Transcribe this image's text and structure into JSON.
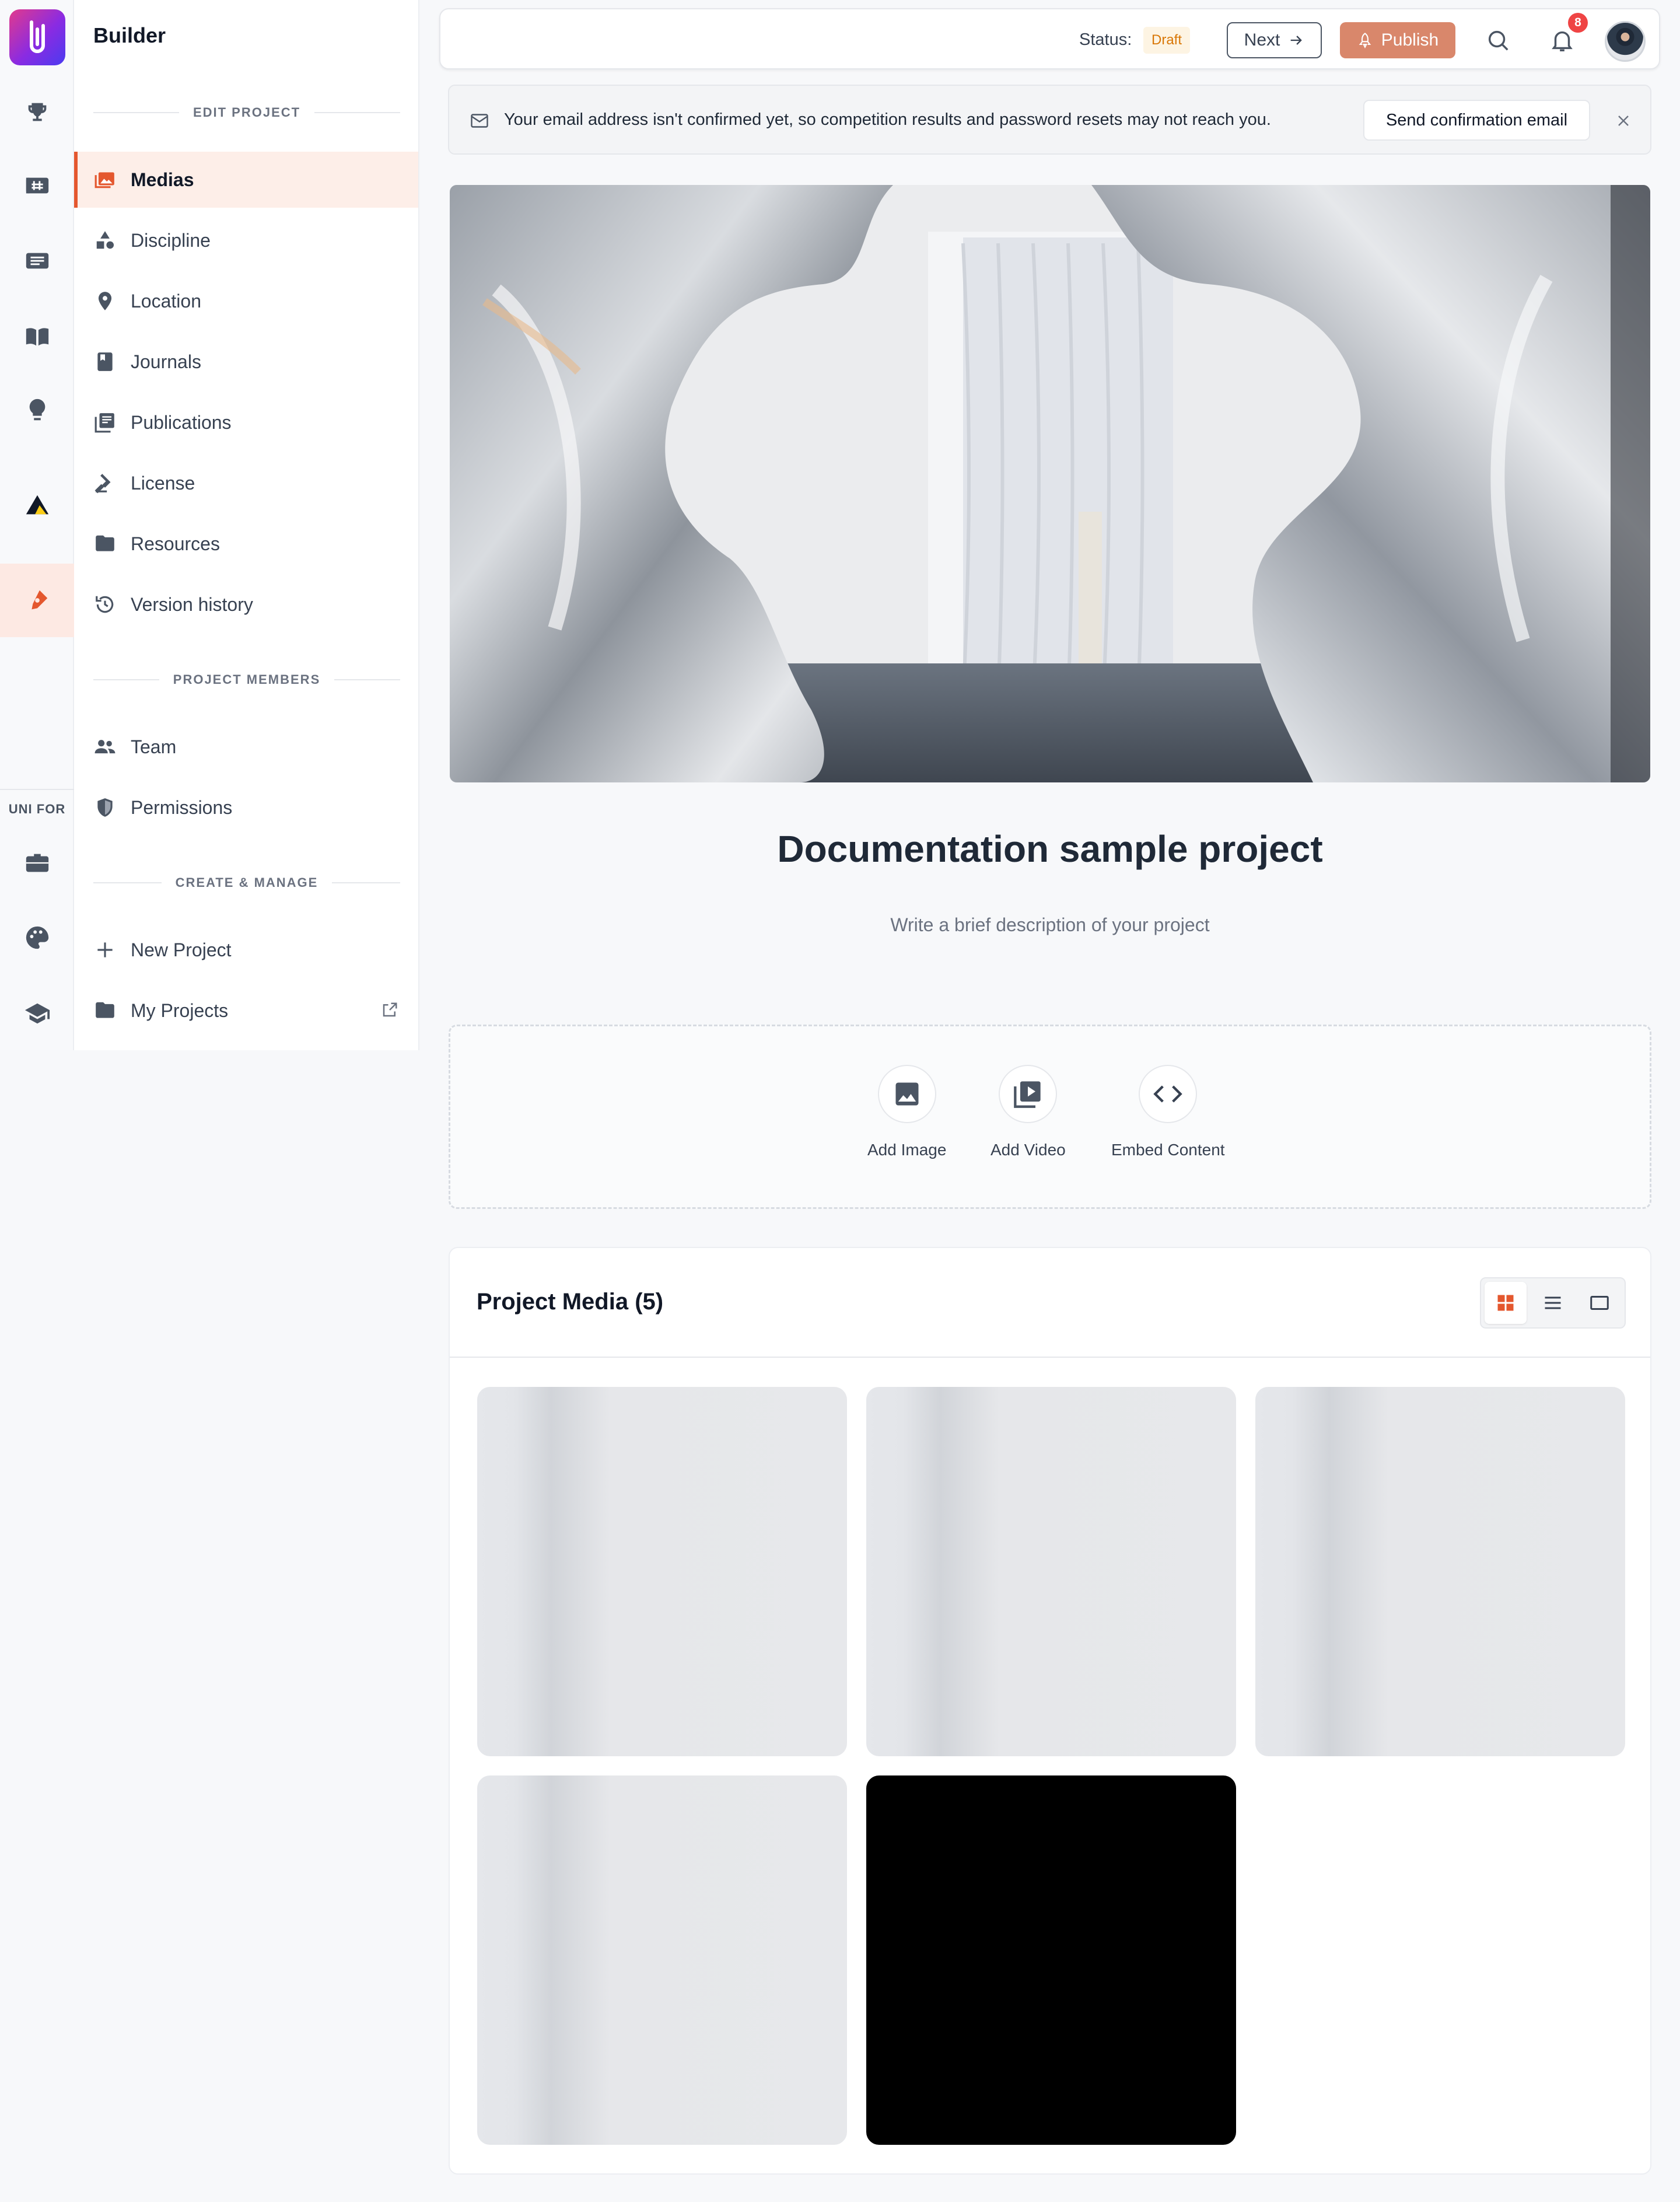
{
  "rail": {
    "section_label": "UNI FOR",
    "icons": [
      "trophy-icon",
      "hashtag-board-icon",
      "list-card-icon",
      "book-open-icon",
      "lightbulb-icon",
      "triangle-logo-icon",
      "builder-pen-icon",
      "briefcase-icon",
      "palette-icon",
      "graduation-cap-icon"
    ]
  },
  "sidebar": {
    "app_name": "Builder",
    "edit_section": "EDIT PROJECT",
    "edit_items": [
      "Medias",
      "Discipline",
      "Location",
      "Journals",
      "Publications",
      "License",
      "Resources",
      "Version history"
    ],
    "members_section": "PROJECT MEMBERS",
    "members_items": [
      "Team",
      "Permissions"
    ],
    "manage_section": "CREATE & MANAGE",
    "manage_items": [
      "New Project",
      "My Projects"
    ]
  },
  "topbar": {
    "status_label": "Status:",
    "status_value": "Draft",
    "next_label": "Next",
    "publish_label": "Publish",
    "notification_count": "8"
  },
  "alert": {
    "message": "Your email address isn't confirmed yet, so competition results and password resets may not reach you.",
    "button": "Send confirmation email"
  },
  "project": {
    "title": "Documentation sample project",
    "description_placeholder": "Write a brief description of your project"
  },
  "add_media": {
    "image": "Add Image",
    "video": "Add Video",
    "embed": "Embed Content"
  },
  "media": {
    "title": "Project Media (5)",
    "view_modes": [
      "grid",
      "list",
      "single"
    ],
    "active_view": "grid"
  },
  "colors": {
    "accent": "#e4572e",
    "publish": "#d9876b",
    "draft_text": "#d97706",
    "notification": "#ef4444"
  }
}
